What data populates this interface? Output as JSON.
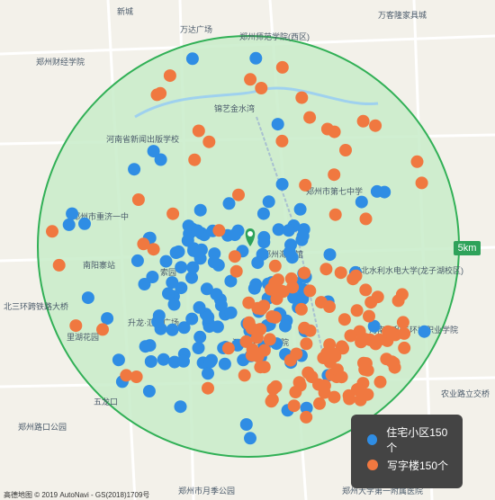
{
  "map": {
    "labels": [
      {
        "t": "新城"
      },
      {
        "t": "万达广场"
      },
      {
        "t": "万客隆家具城"
      },
      {
        "t": "郑州师范学院(西区)"
      },
      {
        "t": "郑州财经学院"
      },
      {
        "t": "锦艺金水湾"
      },
      {
        "t": "河南省新闻出版学校"
      },
      {
        "t": "郑州市第七中学"
      },
      {
        "t": "郑州市重济一中"
      },
      {
        "t": "郑州海洋馆"
      },
      {
        "t": "南阳寨站"
      },
      {
        "t": "索园"
      },
      {
        "t": "华北水利水电大学(龙子湖校区)"
      },
      {
        "t": "北三环跨铁路大桥"
      },
      {
        "t": "升龙·汇金广场"
      },
      {
        "t": "河南省人民医院"
      },
      {
        "t": "河南水利与环境职业学院"
      },
      {
        "t": "里湖花园"
      },
      {
        "t": "五龙口"
      },
      {
        "t": "郑州路口公园"
      },
      {
        "t": "农业路立交桥"
      },
      {
        "t": "郑州市月季公园"
      },
      {
        "t": "郑州大学第一附属医院"
      }
    ]
  },
  "scale": {
    "label": "5km"
  },
  "legend": {
    "items": [
      {
        "label": "住宅小区150个",
        "color": "#2f8de4"
      },
      {
        "label": "写字楼150个",
        "color": "#f07840"
      }
    ]
  },
  "copyright": "高德地图 © 2019 AutoNavi - GS(2018)1709号",
  "colors": {
    "circle_fill": "#c8ecc9",
    "circle_stroke": "#31b056",
    "blue": "#2f8de4",
    "orange": "#f07840"
  }
}
